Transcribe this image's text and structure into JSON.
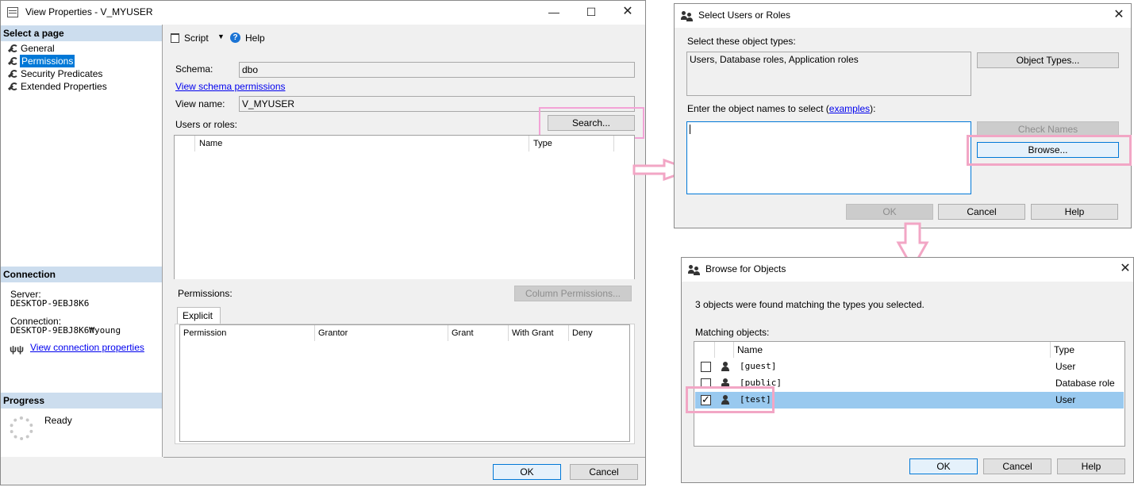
{
  "view_props": {
    "title": "View Properties - V_MYUSER",
    "select_page": "Select a page",
    "pages": [
      "General",
      "Permissions",
      "Security Predicates",
      "Extended Properties"
    ],
    "toolbar": {
      "script": "Script",
      "help": "Help"
    },
    "schema_label": "Schema:",
    "schema_value": "dbo",
    "view_schema_link": "View schema permissions",
    "view_name_label": "View name:",
    "view_name_value": "V_MYUSER",
    "users_roles_label": "Users or roles:",
    "search_btn": "Search...",
    "users_cols": [
      "Name",
      "Type"
    ],
    "permissions_label": "Permissions:",
    "column_perms_btn": "Column Permissions...",
    "explicit_tab": "Explicit",
    "perm_cols": [
      "Permission",
      "Grantor",
      "Grant",
      "With Grant",
      "Deny"
    ],
    "connection_head": "Connection",
    "server_label": "Server:",
    "server_value": "DESKTOP-9EBJ8K6",
    "connection_label": "Connection:",
    "connection_value": "DESKTOP-9EBJ8K6₩young",
    "view_conn_link": "View connection properties",
    "progress_head": "Progress",
    "progress_status": "Ready",
    "ok": "OK",
    "cancel": "Cancel"
  },
  "select_users": {
    "title": "Select Users or Roles",
    "object_types_label": "Select these object types:",
    "object_types_value": "Users, Database roles, Application roles",
    "object_types_btn": "Object Types...",
    "enter_names_label": "Enter the object names to select (",
    "examples_link": "examples",
    "enter_names_suffix": "):",
    "check_names_btn": "Check Names",
    "browse_btn": "Browse...",
    "ok": "OK",
    "cancel": "Cancel",
    "help": "Help"
  },
  "browse_objects": {
    "title": "Browse for Objects",
    "found_text": "3 objects were found matching the types you selected.",
    "matching_label": "Matching objects:",
    "cols": [
      "Name",
      "Type"
    ],
    "rows": [
      {
        "name": "[guest]",
        "type": "User",
        "checked": false,
        "selected": false
      },
      {
        "name": "[public]",
        "type": "Database role",
        "checked": false,
        "selected": false
      },
      {
        "name": "[test]",
        "type": "User",
        "checked": true,
        "selected": true
      }
    ],
    "ok": "OK",
    "cancel": "Cancel",
    "help": "Help"
  },
  "colors": {
    "highlight": "#f3a3d6",
    "selection": "#99c9ef",
    "accent": "#0078d7",
    "link": "#0000ee"
  }
}
